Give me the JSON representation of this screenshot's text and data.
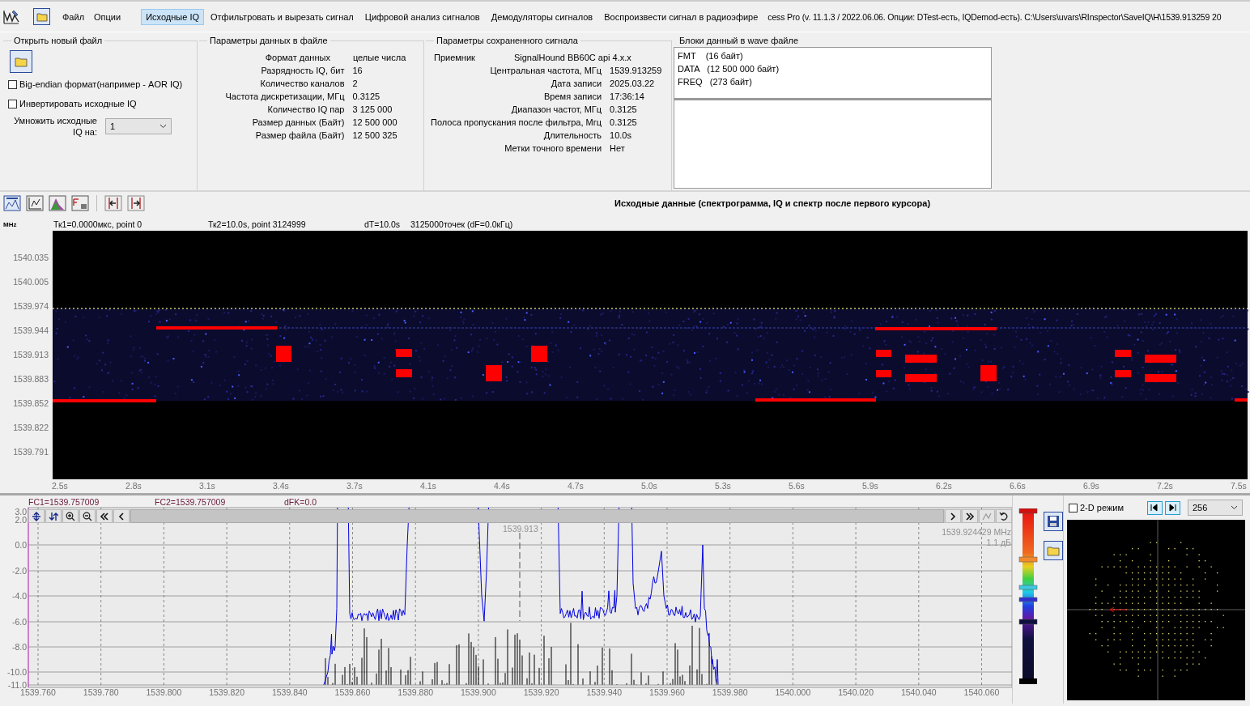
{
  "menu": [
    {
      "label": "Файл"
    },
    {
      "label": "Опции"
    }
  ],
  "tabs": [
    {
      "label": "Исходные IQ",
      "selected": true
    },
    {
      "label": "Отфильтровать и вырезать сигнал",
      "selected": false
    },
    {
      "label": "Цифровой анализ сигналов",
      "selected": false
    },
    {
      "label": "Демодуляторы сигналов",
      "selected": false
    },
    {
      "label": "Воспроизвести сигнал в радиоэфире",
      "selected": false
    }
  ],
  "window_title": "cess Pro (v. 11.1.3 / 2022.06.06. Опции: DTest-есть, IQDemod-есть). C:\\Users\\uvars\\RInspector\\SaveIQ\\H\\1539.913259 20",
  "open_file": {
    "title": "Открыть новый файл",
    "options": [
      {
        "label": "Big-endian формат(например - AOR IQ)",
        "checked": false
      },
      {
        "label": "Инвертировать исходные IQ",
        "checked": false
      }
    ],
    "multiply_label": "Умножить исходные IQ на:",
    "multiply_value": "1"
  },
  "file_params": {
    "title": "Параметры данных в файле",
    "rows": [
      {
        "label": "Формат данных",
        "value": "целые числа"
      },
      {
        "label": "Разрядность IQ, бит",
        "value": "16"
      },
      {
        "label": "Количество каналов",
        "value": "2"
      },
      {
        "label": "Частота дискретизации, МГц",
        "value": "0.3125"
      },
      {
        "label": "Количество IQ пар",
        "value": "3 125 000"
      },
      {
        "label": "Размер данных (Байт)",
        "value": "12 500 000"
      },
      {
        "label": "Размер файла (Байт)",
        "value": "12 500 325"
      }
    ]
  },
  "saved_params": {
    "title": "Параметры сохраненного сигнала",
    "rows": [
      {
        "label": "Приемник",
        "value": "SignalHound BB60C api 4.x.x"
      },
      {
        "label": "Центральная частота, МГц",
        "value": "1539.913259"
      },
      {
        "label": "Дата записи",
        "value": "2025.03.22"
      },
      {
        "label": "Время записи",
        "value": "17:36:14"
      },
      {
        "label": "Диапазон частот, МГц",
        "value": "0.3125"
      },
      {
        "label": "Полоса пропускания после фильтра, Мгц",
        "value": "0.3125"
      },
      {
        "label": "Длительность",
        "value": "10.0s"
      },
      {
        "label": "Метки точного времени",
        "value": "Нет"
      }
    ]
  },
  "wave_blocks": {
    "title": "Блоки данный в wave файле",
    "items": [
      "FMT    (16 байт)",
      "DATA   (12 500 000 байт)",
      "FREQ   (273 байт)"
    ]
  },
  "spectrogram": {
    "title": "Исходные данные (спектрограмма, IQ и спектр после первого курсора)",
    "y_unit": "MHz",
    "cursors": [
      "Тк1=0.0000мкс, point 0",
      "Тк2=10.0s, point 3124999",
      "dT=10.0s",
      "3125000точек (dF=0.0кГц)"
    ],
    "y_ticks": [
      "1540.035",
      "1540.005",
      "1539.974",
      "1539.944",
      "1539.913",
      "1539.883",
      "1539.852",
      "1539.822",
      "1539.791"
    ],
    "x_ticks": [
      "2.5s",
      "2.8s",
      "3.1s",
      "3.4s",
      "3.7s",
      "4.1s",
      "4.4s",
      "4.7s",
      "5.0s",
      "5.3s",
      "5.6s",
      "5.9s",
      "6.2s",
      "6.6s",
      "6.9s",
      "7.2s",
      "7.5s"
    ]
  },
  "spectrum": {
    "cursors": [
      "FC1=1539.757009",
      "FC2=1539.757009",
      "dFK=0.0"
    ],
    "y_ticks": [
      "3.0",
      "2.0",
      "0.0",
      "-2.0",
      "-4.0",
      "-6.0",
      "-8.0",
      "-10.0",
      "-11.0"
    ],
    "x_ticks": [
      "1539.760",
      "1539.780",
      "1539.800",
      "1539.820",
      "1539.840",
      "1539.860",
      "1539.880",
      "1539.900",
      "1539.920",
      "1539.940",
      "1539.960",
      "1539.980",
      "1540.000",
      "1540.020",
      "1540.040",
      "1540.060"
    ],
    "marker_label": "1539.913",
    "readout": [
      "1539.924429 MHz",
      "1.1 дБ"
    ]
  },
  "constellation": {
    "mode_label": "2-D режим",
    "mode_checked": false,
    "points": "256"
  }
}
